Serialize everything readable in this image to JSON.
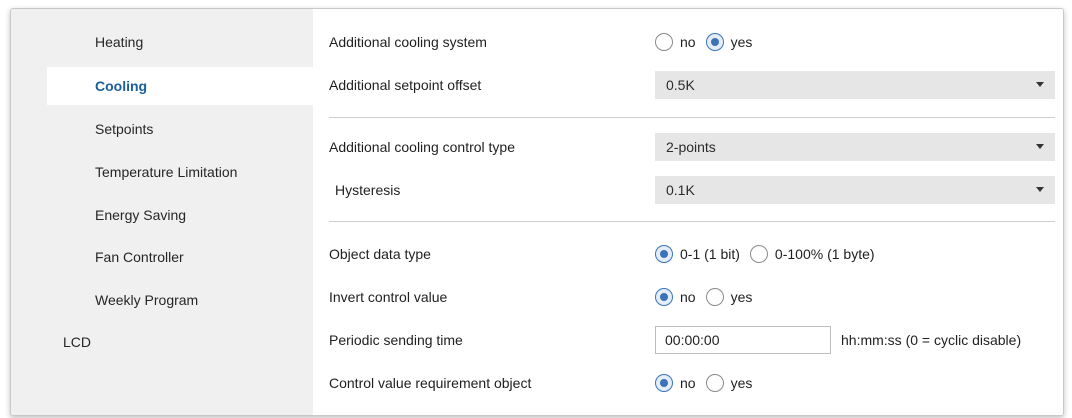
{
  "sidebar": {
    "items": [
      {
        "label": "Heating"
      },
      {
        "label": "Cooling"
      },
      {
        "label": "Setpoints"
      },
      {
        "label": "Temperature Limitation"
      },
      {
        "label": "Energy Saving"
      },
      {
        "label": "Fan Controller"
      },
      {
        "label": "Weekly Program"
      },
      {
        "label": "LCD"
      }
    ],
    "active": "Cooling"
  },
  "main": {
    "additional_cooling_system": {
      "label": "Additional cooling system",
      "opt1": "no",
      "opt2": "yes",
      "selected": "yes"
    },
    "additional_setpoint_offset": {
      "label": "Additional setpoint offset",
      "value": "0.5K"
    },
    "additional_cooling_control_type": {
      "label": "Additional cooling control type",
      "value": "2-points"
    },
    "hysteresis": {
      "label": "Hysteresis",
      "value": "0.1K"
    },
    "object_data_type": {
      "label": "Object data type",
      "opt1": "0-1 (1 bit)",
      "opt2": "0-100% (1 byte)",
      "selected": "0-1 (1 bit)"
    },
    "invert_control_value": {
      "label": "Invert control value",
      "opt1": "no",
      "opt2": "yes",
      "selected": "no"
    },
    "periodic_sending_time": {
      "label": "Periodic sending time",
      "value": "00:00:00",
      "suffix": "hh:mm:ss (0 = cyclic disable)"
    },
    "control_value_requirement_object": {
      "label": "Control value requirement object",
      "opt1": "no",
      "opt2": "yes",
      "selected": "no"
    }
  },
  "colors": {
    "accent": "#3c73b6",
    "active_nav_text": "#1b5e9e",
    "sidebar_bg": "#f0f0f0",
    "select_bg": "#e6e6e6"
  }
}
